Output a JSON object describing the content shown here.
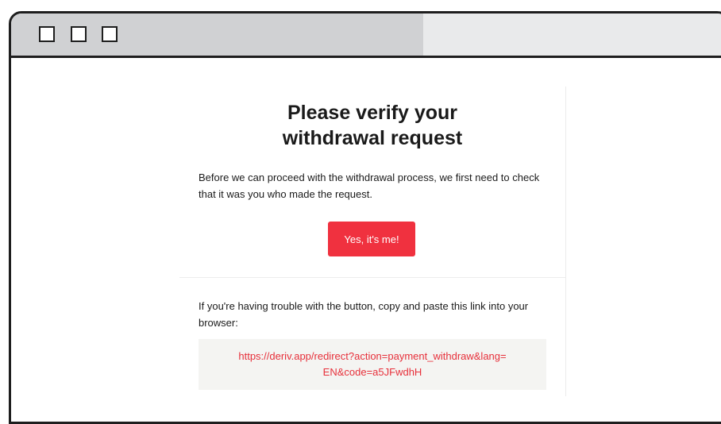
{
  "window": {
    "controls": [
      "window-button-1",
      "window-button-2",
      "window-button-3"
    ]
  },
  "email": {
    "title_line1": "Please verify your",
    "title_line2": "withdrawal request",
    "intro": "Before we can proceed with the withdrawal process, we first need to check that it was you who made the request.",
    "confirm_button": "Yes, it's me!",
    "fallback_text": "If you're having trouble with the button, copy and paste this link into your browser:",
    "fallback_link_line1": "https://deriv.app/redirect?action=payment_withdraw&lang=",
    "fallback_link_line2": "EN&code=a5JFwdhH"
  },
  "colors": {
    "accent": "#f0313f",
    "link": "#e7303b",
    "titlebar": "#d0d1d3",
    "linkbox_bg": "#f4f4f2"
  }
}
